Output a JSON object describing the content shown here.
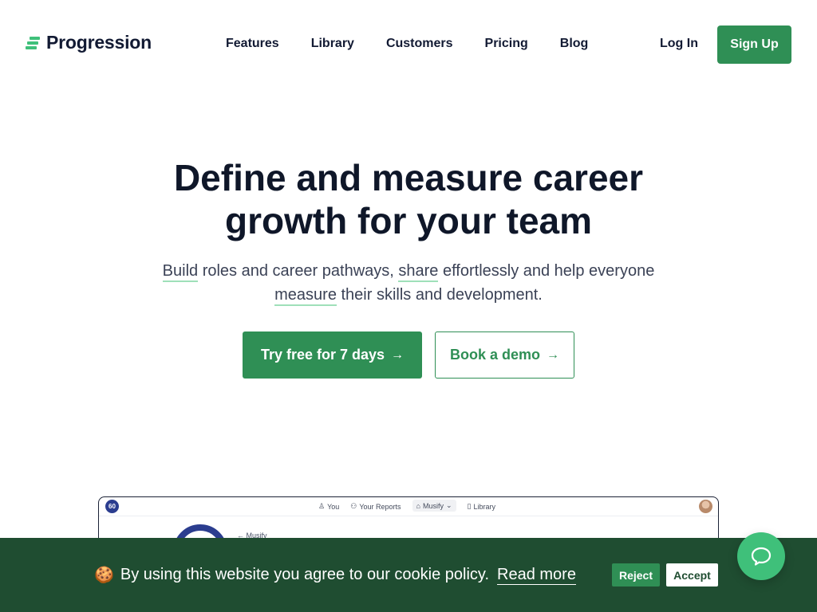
{
  "brand": {
    "name": "Progression",
    "accent": "#2f8f55",
    "accent_light": "#3fc07a",
    "dark": "#1f4d31"
  },
  "nav": {
    "links": [
      "Features",
      "Library",
      "Customers",
      "Pricing",
      "Blog"
    ],
    "login": "Log In",
    "signup": "Sign Up"
  },
  "hero": {
    "title_line1": "Define and measure career",
    "title_line2": "growth for your team",
    "sub": {
      "w1": "Build",
      "t1": " roles and career pathways, ",
      "w2": "share",
      "t2": " effortlessly and help everyone",
      "w3": "measure",
      "t3": " their skills and development."
    },
    "cta_primary": "Try free for 7 days",
    "cta_secondary": "Book a demo",
    "arrow": "→"
  },
  "preview": {
    "logo_text": "60",
    "nav": [
      {
        "icon": "person-icon",
        "glyph": "♙",
        "label": "You"
      },
      {
        "icon": "people-icon",
        "glyph": "⚇",
        "label": "Your Reports"
      },
      {
        "icon": "org-icon",
        "glyph": "⌂",
        "label": "Musify",
        "dropdown": "⌄"
      },
      {
        "icon": "book-icon",
        "glyph": "▯",
        "label": "Library"
      }
    ],
    "back_link": "← Musify"
  },
  "cookie": {
    "emoji": "🍪",
    "text": "By using this website you agree to our cookie policy.",
    "link": "Read more",
    "reject": "Reject",
    "accept": "Accept"
  }
}
